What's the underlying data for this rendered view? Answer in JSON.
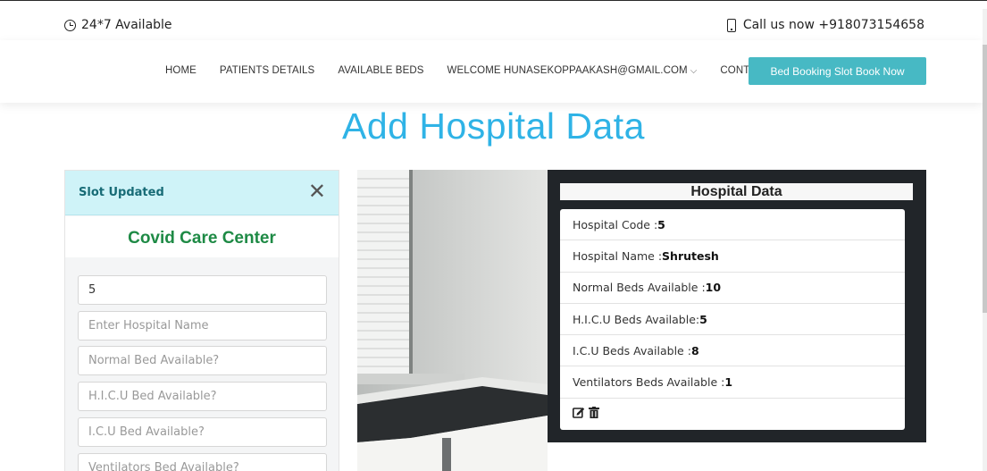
{
  "topbar": {
    "availability": "24*7 Available",
    "call": "Call us now +918073154658"
  },
  "nav": {
    "items": [
      "HOME",
      "PATIENTS DETAILS",
      "AVAILABLE BEDS",
      "WELCOME HUNASEKOPPAAKASH@GMAIL.COM",
      "CONTACT"
    ],
    "cta": "Bed Booking Slot Book Now",
    "accent": "#47b9c4"
  },
  "page": {
    "title": "Add Hospital Data",
    "title_color": "#2fb3e6"
  },
  "form": {
    "alert": "Slot Updated",
    "heading": "Covid Care Center",
    "fields": [
      {
        "value": "5",
        "placeholder": ""
      },
      {
        "value": "",
        "placeholder": "Enter Hospital Name"
      },
      {
        "value": "",
        "placeholder": "Normal Bed Available?"
      },
      {
        "value": "",
        "placeholder": "H.I.C.U Bed Available?"
      },
      {
        "value": "",
        "placeholder": "I.C.U Bed Available?"
      },
      {
        "value": "",
        "placeholder": "Ventilators Bed Available?"
      }
    ]
  },
  "hospital": {
    "title": "Hospital Data",
    "rows": [
      {
        "label": "Hospital Code : ",
        "value": "5"
      },
      {
        "label": "Hospital Name : ",
        "value": "Shrutesh"
      },
      {
        "label": "Normal Beds Available :",
        "value": "10"
      },
      {
        "label": "H.I.C.U Beds Available: ",
        "value": "5"
      },
      {
        "label": "I.C.U Beds Available :",
        "value": "8"
      },
      {
        "label": "Ventilators Beds Available : ",
        "value": "1"
      }
    ],
    "icons": [
      "edit-icon",
      "trash-icon"
    ]
  }
}
